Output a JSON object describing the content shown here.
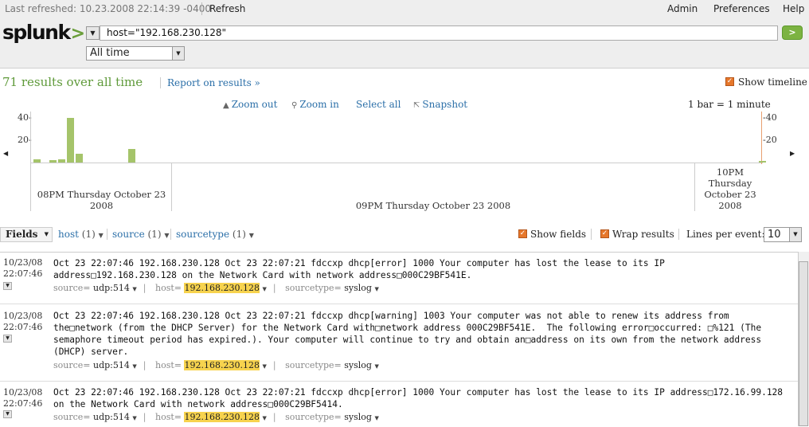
{
  "header": {
    "last_refreshed_label": "Last refreshed:",
    "last_refreshed_value": "10.23.2008 22:14:39 -0400",
    "refresh": "Refresh",
    "nav": [
      "Admin",
      "Preferences",
      "Help"
    ],
    "logo": "splunk",
    "logo_suffix": ">",
    "search_query": "host=\"192.168.230.128\"",
    "go_label": ">",
    "time_range": "All time"
  },
  "results": {
    "count_text": "71 results over all time",
    "report_link": "Report on results »",
    "show_timeline": "Show timeline"
  },
  "timeline": {
    "tools": [
      "Zoom out",
      "Zoom in",
      "Select all",
      "Snapshot"
    ],
    "scale_text": "1 bar = 1 minute",
    "y_ticks": [
      "40-",
      "20-"
    ],
    "y_ticks_right": [
      "-40",
      "-20"
    ],
    "bars": [
      3,
      2,
      3,
      5,
      40,
      8,
      12,
      1
    ],
    "y_max": 40,
    "date_left_line1": "08PM Thursday October 23",
    "date_left_line2": "2008",
    "date_mid": "09PM Thursday October 23 2008",
    "date_right": [
      "10PM",
      "Thursday",
      "October 23",
      "2008"
    ]
  },
  "fields_bar": {
    "fields_button": "Fields",
    "chips": [
      {
        "name": "host",
        "count": "(1)"
      },
      {
        "name": "source",
        "count": "(1)"
      },
      {
        "name": "sourcetype",
        "count": "(1)"
      }
    ],
    "show_fields": "Show fields",
    "wrap_results": "Wrap results",
    "lines_per_event_label": "Lines per event:",
    "lines_per_event_value": "10"
  },
  "events": [
    {
      "date": "10/23/08",
      "time": "22:07:46",
      "raw": "Oct 23 22:07:46 192.168.230.128 Oct 23 22:07:21 fdccxp dhcp[error] 1000 Your computer has lost the lease to its IP address□192.168.230.128 on the Network Card with network address□000C29BF541E.",
      "source": "udp:514",
      "host": "192.168.230.128",
      "sourcetype": "syslog"
    },
    {
      "date": "10/23/08",
      "time": "22:07:46",
      "raw": "Oct 23 22:07:46 192.168.230.128 Oct 23 22:07:21 fdccxp dhcp[warning] 1003 Your computer was not able to renew its address from the□network (from the DHCP Server) for the Network Card with□network address 000C29BF541E.  The following error□occurred: □%121 (The semaphore timeout period has expired.). Your computer will continue to try and obtain an□address on its own from the network address (DHCP) server.",
      "source": "udp:514",
      "host": "192.168.230.128",
      "sourcetype": "syslog"
    },
    {
      "date": "10/23/08",
      "time": "22:07:46",
      "raw": "Oct 23 22:07:46 192.168.230.128 Oct 23 22:07:21 fdccxp dhcp[error] 1000 Your computer has lost the lease to its IP address□172.16.99.128 on the Network Card with network address□000C29BF5414.",
      "source": "udp:514",
      "host": "192.168.230.128",
      "sourcetype": "syslog"
    }
  ],
  "labels": {
    "source_key": "source=",
    "host_key": "host=",
    "sourcetype_key": "sourcetype="
  }
}
